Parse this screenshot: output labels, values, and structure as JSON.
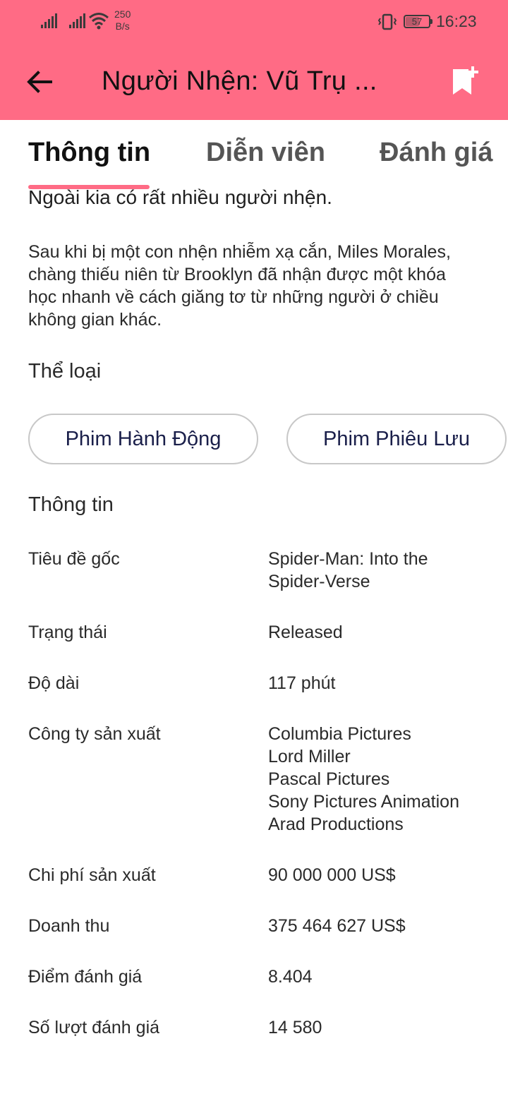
{
  "status_bar": {
    "network_speed_value": "250",
    "network_speed_unit": "B/s",
    "battery": "57",
    "time": "16:23"
  },
  "app_bar": {
    "title": "Người Nhện: Vũ Trụ ...",
    "back_icon": "arrow-left-icon",
    "bookmark_icon": "bookmark-add-icon",
    "background": "#ff6b85"
  },
  "tabs": [
    {
      "label": "Thông tin",
      "active": true
    },
    {
      "label": "Diễn viên",
      "active": false
    },
    {
      "label": "Đánh giá",
      "active": false
    }
  ],
  "content": {
    "tagline": "Ngoài kia có rất nhiều người nhện.",
    "overview": "Sau khi bị một con nhện nhiễm xạ cắn, Miles Morales, chàng thiếu niên từ Brooklyn đã nhận được một khóa học nhanh về cách giăng tơ từ những người ở chiều không gian khác.",
    "genres_title": "Thể loại",
    "genres": [
      "Phim Hành Động",
      "Phim Phiêu Lưu"
    ],
    "info_title": "Thông tin",
    "info": [
      {
        "label": "Tiêu đề gốc",
        "value": [
          "Spider-Man: Into the",
          "Spider-Verse"
        ]
      },
      {
        "label": "Trạng thái",
        "value": [
          "Released"
        ]
      },
      {
        "label": "Độ dài",
        "value": [
          "117 phút"
        ]
      },
      {
        "label": "Công ty sản xuất",
        "value": [
          "Columbia Pictures",
          "Lord Miller",
          "Pascal Pictures",
          "Sony Pictures Animation",
          "Arad Productions"
        ]
      },
      {
        "label": "Chi phí sản xuất",
        "value": [
          "90 000 000 US$"
        ]
      },
      {
        "label": "Doanh thu",
        "value": [
          "375 464 627 US$"
        ]
      },
      {
        "label": "Điểm đánh giá",
        "value": [
          "8.404"
        ]
      },
      {
        "label": "Số lượt đánh giá",
        "value": [
          "14 580"
        ]
      }
    ]
  }
}
